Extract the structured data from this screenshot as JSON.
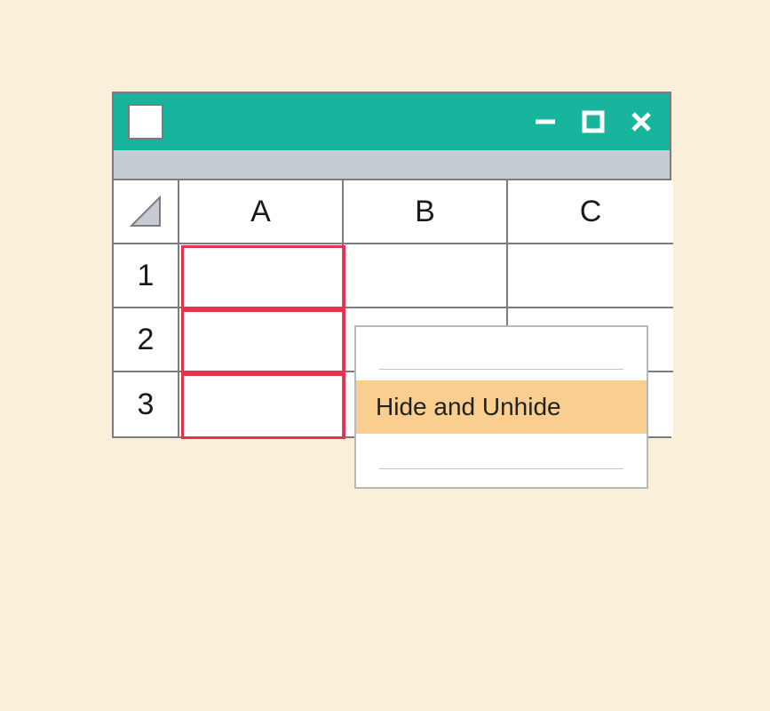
{
  "columns": [
    "A",
    "B",
    "C"
  ],
  "rows": [
    "1",
    "2",
    "3"
  ],
  "context_menu": {
    "hide_unhide": "Hide and Unhide"
  }
}
